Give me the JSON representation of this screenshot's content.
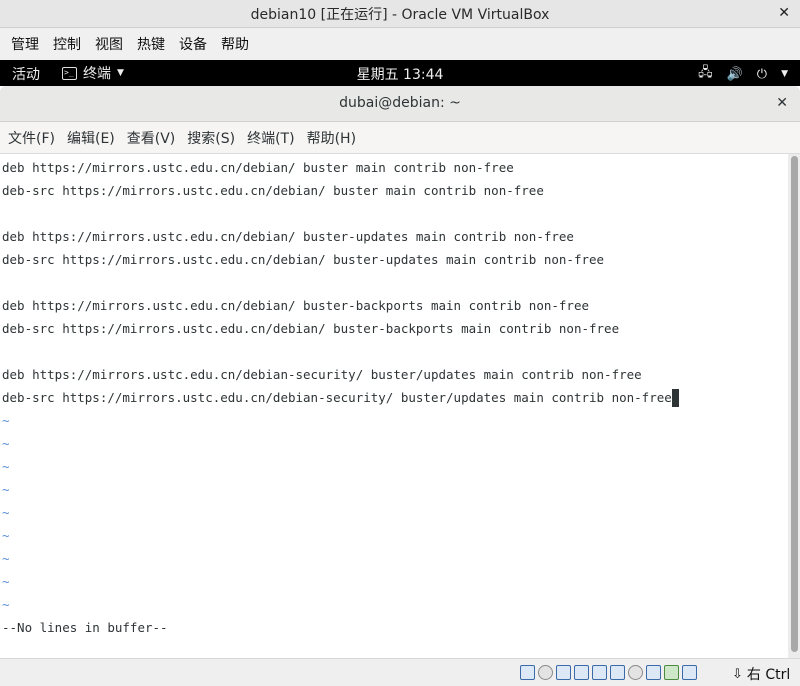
{
  "vbox": {
    "window_title": "debian10 [正在运行] - Oracle VM VirtualBox",
    "close_glyph": "✕",
    "menu": [
      "管理",
      "控制",
      "视图",
      "热键",
      "设备",
      "帮助"
    ],
    "host_key": "右 Ctrl",
    "host_key_arrow": "⇩"
  },
  "gnome": {
    "activities": "活动",
    "app_menu_label": "终端",
    "app_menu_icon_text": ">_",
    "app_menu_caret": "▼",
    "clock": "星期五 13:44",
    "status_icons": {
      "network": "🖧",
      "volume": "🔊",
      "power": "⏻",
      "caret": "▼"
    }
  },
  "terminal": {
    "window_title": "dubai@debian: ~",
    "close_glyph": "✕",
    "menu": [
      "文件(F)",
      "编辑(E)",
      "查看(V)",
      "搜索(S)",
      "终端(T)",
      "帮助(H)"
    ],
    "lines": [
      "deb https://mirrors.ustc.edu.cn/debian/ buster main contrib non-free",
      "deb-src https://mirrors.ustc.edu.cn/debian/ buster main contrib non-free",
      "",
      "deb https://mirrors.ustc.edu.cn/debian/ buster-updates main contrib non-free",
      "deb-src https://mirrors.ustc.edu.cn/debian/ buster-updates main contrib non-free",
      "",
      "deb https://mirrors.ustc.edu.cn/debian/ buster-backports main contrib non-free",
      "deb-src https://mirrors.ustc.edu.cn/debian/ buster-backports main contrib non-free",
      "",
      "deb https://mirrors.ustc.edu.cn/debian-security/ buster/updates main contrib non-free",
      "deb-src https://mirrors.ustc.edu.cn/debian-security/ buster/updates main contrib non-free"
    ],
    "tilde_lines": [
      "~",
      "~",
      "~",
      "~",
      "~",
      "~",
      "~",
      "~",
      "~"
    ],
    "status_message": "--No lines in buffer--"
  }
}
